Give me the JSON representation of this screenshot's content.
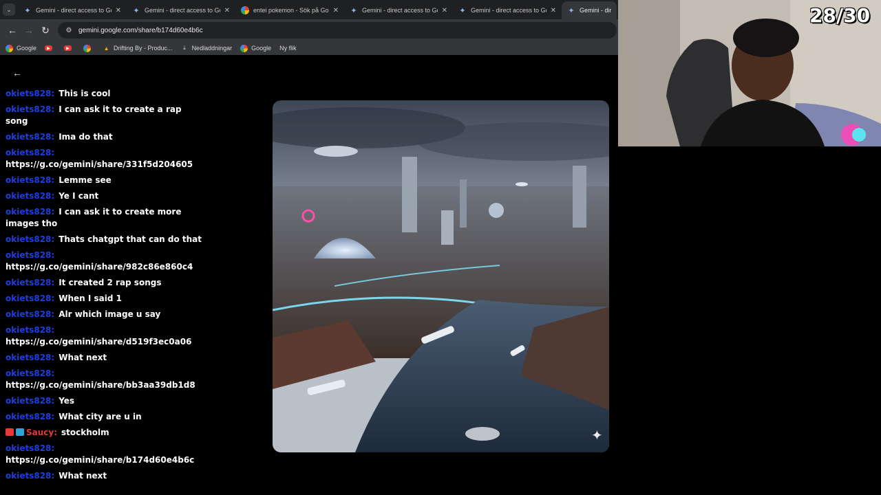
{
  "tabs": [
    {
      "title": "Gemini - direct access to Goog",
      "icon": "gemini-icon",
      "active": false
    },
    {
      "title": "Gemini - direct access to Goog",
      "icon": "gemini-icon",
      "active": false
    },
    {
      "title": "entei pokemon - Sök på Googl",
      "icon": "google-icon",
      "active": false
    },
    {
      "title": "Gemini - direct access to Goog",
      "icon": "gemini-icon",
      "active": false
    },
    {
      "title": "Gemini - direct access to Goog",
      "icon": "gemini-icon",
      "active": false
    },
    {
      "title": "Gemini - direct a",
      "icon": "gemini-icon",
      "active": true
    }
  ],
  "toolbar": {
    "url": "gemini.google.com/share/b174d60e4b6c"
  },
  "bookmarks": [
    {
      "label": "Google",
      "icon": "google-icon"
    },
    {
      "label": "",
      "icon": "youtube-icon"
    },
    {
      "label": "",
      "icon": "youtube-icon"
    },
    {
      "label": "",
      "icon": "google-icon"
    },
    {
      "label": "Drifting By - Produc...",
      "icon": "warning-icon"
    },
    {
      "label": "Nedladdningar",
      "icon": "download-icon"
    },
    {
      "label": "Google",
      "icon": "google-icon"
    },
    {
      "label": "Ny flik",
      "icon": ""
    }
  ],
  "chat": [
    {
      "user": "okiets828:",
      "text": "This is cool",
      "inline": true
    },
    {
      "user": "okiets828:",
      "text": "I can ask it to create a rap song",
      "inline": true
    },
    {
      "user": "okiets828:",
      "text": "Ima do that",
      "inline": true
    },
    {
      "user": "okiets828:",
      "text": "https://g.co/gemini/share/331f5d204605",
      "inline": false
    },
    {
      "user": "okiets828:",
      "text": "Lemme see",
      "inline": true
    },
    {
      "user": "okiets828:",
      "text": "Ye I cant",
      "inline": true
    },
    {
      "user": "okiets828:",
      "text": "I can ask it to create more images tho",
      "inline": true
    },
    {
      "user": "okiets828:",
      "text": "Thats chatgpt that can do that",
      "inline": true
    },
    {
      "user": "okiets828:",
      "text": "https://g.co/gemini/share/982c86e860c4",
      "inline": false
    },
    {
      "user": "okiets828:",
      "text": "It created 2 rap songs",
      "inline": true
    },
    {
      "user": "okiets828:",
      "text": "When I said 1",
      "inline": true
    },
    {
      "user": "okiets828:",
      "text": "Alr which image u say",
      "inline": true
    },
    {
      "user": "okiets828:",
      "text": "https://g.co/gemini/share/d519f3ec0a06",
      "inline": false
    },
    {
      "user": "okiets828:",
      "text": "What next",
      "inline": true
    },
    {
      "user": "okiets828:",
      "text": "https://g.co/gemini/share/bb3aa39db1d8",
      "inline": false
    },
    {
      "user": "okiets828:",
      "text": "Yes",
      "inline": true
    },
    {
      "user": "okiets828:",
      "text": "What city are u in",
      "inline": true
    },
    {
      "user": "Saucy:",
      "text": "stockholm",
      "inline": true,
      "badges": true,
      "red": true
    },
    {
      "user": "okiets828:",
      "text": "https://g.co/gemini/share/b174d60e4b6c",
      "inline": false
    },
    {
      "user": "okiets828:",
      "text": "What next",
      "inline": true
    }
  ],
  "counter": "28/30",
  "colors": {
    "chat_user": "#1d3ee0",
    "chat_user_mod": "#e53935",
    "tab_bg": "#1f2022",
    "toolbar_bg": "#35363a"
  }
}
